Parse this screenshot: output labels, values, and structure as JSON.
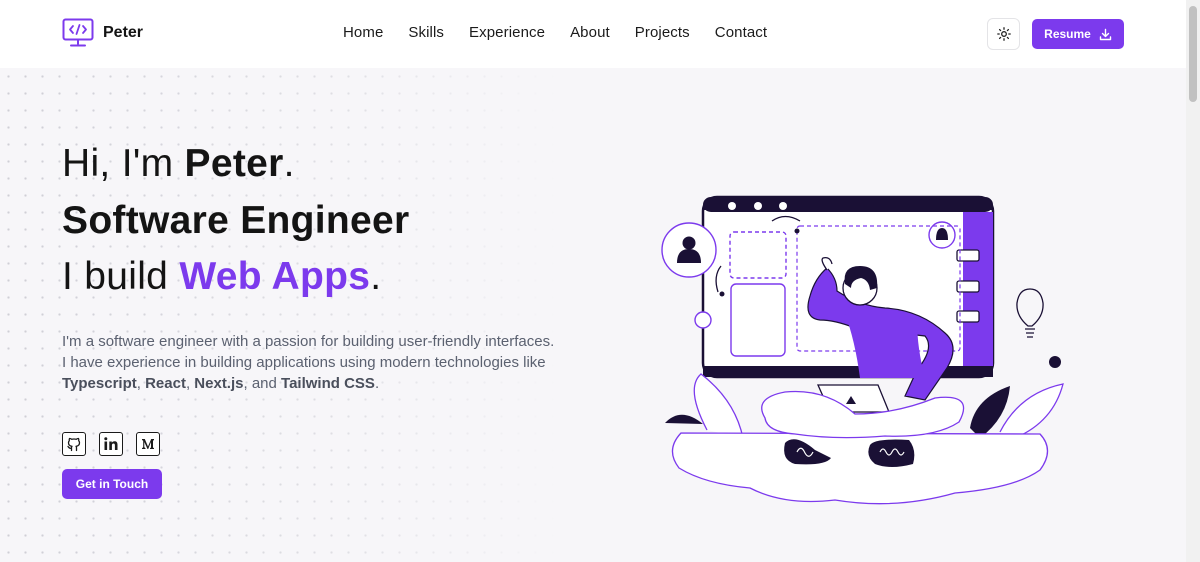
{
  "nav": {
    "brand": "Peter",
    "links": [
      "Home",
      "Skills",
      "Experience",
      "About",
      "Projects",
      "Contact"
    ],
    "resume_label": "Resume",
    "theme_icon": "sun-icon",
    "resume_icon": "download-icon"
  },
  "hero": {
    "greeting_prefix": "Hi, I'm ",
    "name": "Peter",
    "greeting_suffix": ".",
    "role": "Software Engineer",
    "build_prefix": "I build ",
    "build_highlight": "Web Apps",
    "build_suffix": ".",
    "intro_1": "I'm a software engineer with a passion for building user-friendly interfaces. I have experience in building applications using modern technologies like ",
    "tech_1": "Typescript",
    "sep_1": ", ",
    "tech_2": "React",
    "sep_2": ", ",
    "tech_3": "Next.js",
    "sep_3": ", and ",
    "tech_4": "Tailwind CSS",
    "end": ".",
    "cta_label": "Get in Touch"
  },
  "socials": [
    "github-icon",
    "linkedin-icon",
    "medium-icon"
  ],
  "colors": {
    "accent": "#7c3aed",
    "background": "#f7f6f9",
    "nav_bg": "#ffffff"
  }
}
